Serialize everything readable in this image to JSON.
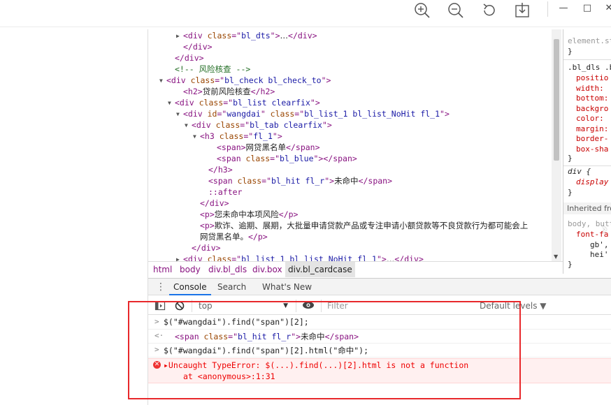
{
  "viewer_toolbar": {
    "zoom_in_icon": "zoom-in",
    "zoom_out_icon": "zoom-out",
    "rotate_icon": "rotate",
    "download_icon": "download",
    "minimize_label": "—",
    "maximize_label": "□",
    "close_label": "✕"
  },
  "elements_tree": [
    {
      "indent": 5,
      "tri": "right",
      "parts": [
        [
          "tag",
          "<div "
        ],
        [
          "attr",
          "class"
        ],
        [
          "tag",
          "=\""
        ],
        [
          "val",
          "bl_dts"
        ],
        [
          "tag",
          "\">"
        ],
        [
          "txt",
          "…"
        ],
        [
          "tag",
          "</div>"
        ]
      ]
    },
    {
      "indent": 5,
      "tri": "",
      "parts": [
        [
          "tag",
          "</div>"
        ]
      ]
    },
    {
      "indent": 4,
      "tri": "",
      "parts": [
        [
          "tag",
          "</div>"
        ]
      ]
    },
    {
      "indent": 4,
      "tri": "",
      "parts": [
        [
          "cmt",
          "<!-- 风险核查 -->"
        ]
      ]
    },
    {
      "indent": 3,
      "tri": "down",
      "parts": [
        [
          "tag",
          "<div "
        ],
        [
          "attr",
          "class"
        ],
        [
          "tag",
          "=\""
        ],
        [
          "val",
          "bl_check bl_check_to"
        ],
        [
          "tag",
          "\">"
        ]
      ]
    },
    {
      "indent": 5,
      "tri": "",
      "parts": [
        [
          "tag",
          "<h2>"
        ],
        [
          "txt",
          "贷前风险核查"
        ],
        [
          "tag",
          "</h2>"
        ]
      ]
    },
    {
      "indent": 4,
      "tri": "down",
      "parts": [
        [
          "tag",
          "<div "
        ],
        [
          "attr",
          "class"
        ],
        [
          "tag",
          "=\""
        ],
        [
          "val",
          "bl_list clearfix"
        ],
        [
          "tag",
          "\">"
        ]
      ]
    },
    {
      "indent": 5,
      "tri": "down",
      "parts": [
        [
          "tag",
          "<div "
        ],
        [
          "attr",
          "id"
        ],
        [
          "tag",
          "=\""
        ],
        [
          "val",
          "wangdai"
        ],
        [
          "tag",
          "\" "
        ],
        [
          "attr",
          "class"
        ],
        [
          "tag",
          "=\""
        ],
        [
          "val",
          "bl_list_1 bl_list_NoHit fl_1"
        ],
        [
          "tag",
          "\">"
        ]
      ]
    },
    {
      "indent": 6,
      "tri": "down",
      "parts": [
        [
          "tag",
          "<div "
        ],
        [
          "attr",
          "class"
        ],
        [
          "tag",
          "=\""
        ],
        [
          "val",
          "bl_tab clearfix"
        ],
        [
          "tag",
          "\">"
        ]
      ]
    },
    {
      "indent": 7,
      "tri": "down",
      "parts": [
        [
          "tag",
          "<h3 "
        ],
        [
          "attr",
          "class"
        ],
        [
          "tag",
          "=\""
        ],
        [
          "val",
          "fl_1"
        ],
        [
          "tag",
          "\">"
        ]
      ]
    },
    {
      "indent": 9,
      "tri": "",
      "parts": [
        [
          "tag",
          "<span>"
        ],
        [
          "txt",
          "网贷黑名单"
        ],
        [
          "tag",
          "</span>"
        ]
      ]
    },
    {
      "indent": 9,
      "tri": "",
      "parts": [
        [
          "tag",
          "<span "
        ],
        [
          "attr",
          "class"
        ],
        [
          "tag",
          "=\""
        ],
        [
          "val",
          "bl_blue"
        ],
        [
          "tag",
          "\"></span>"
        ]
      ]
    },
    {
      "indent": 8,
      "tri": "",
      "parts": [
        [
          "tag",
          "</h3>"
        ]
      ]
    },
    {
      "indent": 8,
      "tri": "",
      "parts": [
        [
          "tag",
          "<span "
        ],
        [
          "attr",
          "class"
        ],
        [
          "tag",
          "=\""
        ],
        [
          "val",
          "bl_hit fl_r"
        ],
        [
          "tag",
          "\">"
        ],
        [
          "txt",
          "未命中"
        ],
        [
          "tag",
          "</span>"
        ]
      ]
    },
    {
      "indent": 8,
      "tri": "",
      "parts": [
        [
          "pseudo",
          "::after"
        ]
      ]
    },
    {
      "indent": 7,
      "tri": "",
      "parts": [
        [
          "tag",
          "</div>"
        ]
      ]
    },
    {
      "indent": 7,
      "tri": "",
      "parts": [
        [
          "tag",
          "<p>"
        ],
        [
          "txt",
          "您未命中本项风险"
        ],
        [
          "tag",
          "</p>"
        ]
      ]
    },
    {
      "indent": 7,
      "tri": "",
      "parts": [
        [
          "tag",
          "<p>"
        ],
        [
          "txt",
          "欺诈、逾期、展期，大批量申请贷款产品或专注申请小额贷款等不良贷款行为都可能会上"
        ]
      ]
    },
    {
      "indent": 7,
      "tri": "",
      "parts": [
        [
          "txt",
          "网贷黑名单。"
        ],
        [
          "tag",
          "</p>"
        ]
      ]
    },
    {
      "indent": 6,
      "tri": "",
      "parts": [
        [
          "tag",
          "</div>"
        ]
      ]
    },
    {
      "indent": 5,
      "tri": "right",
      "parts": [
        [
          "tag",
          "<div "
        ],
        [
          "attr",
          "class"
        ],
        [
          "tag",
          "=\""
        ],
        [
          "val",
          "bl_list_1 bl_list_NoHit fl_1"
        ],
        [
          "tag",
          "\">"
        ],
        [
          "txt",
          "…"
        ],
        [
          "tag",
          "</div>"
        ]
      ]
    }
  ],
  "styles_pane": {
    "element_style": "element.st",
    "close_brace": "}",
    "rule_selector": ".bl_dls .b",
    "props": [
      "positio",
      "width:",
      "bottom:",
      "backgro",
      "color:",
      "margin:",
      "border-",
      "box-sha"
    ],
    "div_selector": "div {",
    "div_prop": "display",
    "inherited_label": "Inherited fro",
    "body_selector": "body, butt",
    "font_prop": "font-fa",
    "font_val1": "gb',",
    "font_val2": "hei'"
  },
  "breadcrumbs": [
    "html",
    "body",
    "div.bl_dls",
    "div.box",
    "div.bl_cardcase"
  ],
  "drawer": {
    "menu_icon": "kebab-menu",
    "tabs": [
      "Console",
      "Search",
      "What's New"
    ],
    "active_tab": "Console"
  },
  "console_toolbar": {
    "context": "top",
    "filter_placeholder": "Filter",
    "levels": "Default levels ▼"
  },
  "console_messages": [
    {
      "type": "input",
      "prompt": ">",
      "text": "$(\"#wangdai\").find(\"span\")[2];"
    },
    {
      "type": "result",
      "prompt": "<·",
      "text": "<span class=\"bl_hit fl_r\">未命中</span>"
    },
    {
      "type": "input",
      "prompt": ">",
      "text": "$(\"#wangdai\").find(\"span\")[2].html(\"命中\");"
    },
    {
      "type": "error",
      "line1": "▸Uncaught TypeError: $(...).find(...)[2].html is not a function",
      "line2": "at <anonymous>:1:31"
    }
  ],
  "console_input_prompt": ">",
  "colors": {
    "tag": "#881280",
    "attribute": "#994500",
    "value": "#1a1aa6",
    "comment": "#236e25",
    "error": "#e00000",
    "highlight": "#e8282b",
    "active_tab": "#1a73e8"
  }
}
